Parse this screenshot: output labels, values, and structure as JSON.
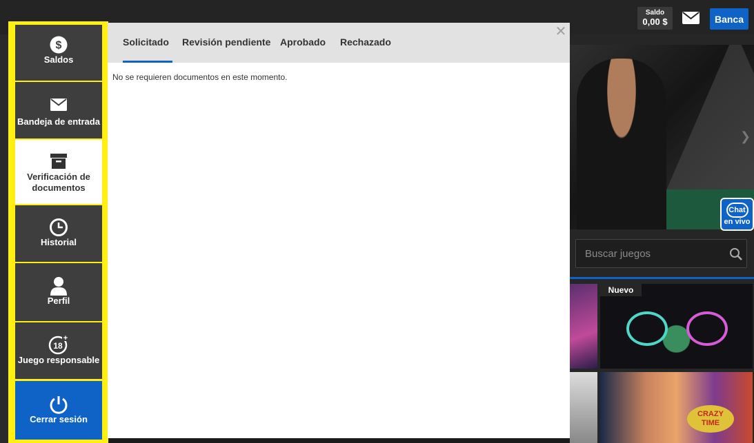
{
  "header": {
    "balance_label": "Saldo",
    "balance_value": "0,00 $",
    "mail_icon": "envelope-icon",
    "banca_label": "Banca"
  },
  "background": {
    "chat_line1": "Chat",
    "chat_line2": "en vivo",
    "search_placeholder": "Buscar juegos",
    "search_icon": "magnifier-icon",
    "new_badge": "Nuevo",
    "crazy_line1": "CRAZY",
    "crazy_line2": "TIME"
  },
  "menu": {
    "items": [
      {
        "label": "Saldos",
        "icon": "dollar-coin-icon"
      },
      {
        "label": "Bandeja de entrada",
        "icon": "envelope-icon"
      },
      {
        "label": "Verificación de documentos",
        "icon": "archive-box-icon"
      },
      {
        "label": "Historial",
        "icon": "clock-icon"
      },
      {
        "label": "Perfil",
        "icon": "user-icon"
      },
      {
        "label": "Juego responsable",
        "icon": "eighteen-plus-icon"
      },
      {
        "label": "Cerrar sesión",
        "icon": "power-icon"
      }
    ],
    "active": "Verificación de documentos",
    "highlight_color": "#ffef12",
    "accent_color": "#0f63c6"
  },
  "modal": {
    "tabs": [
      "Solicitado",
      "Revisión pendiente",
      "Aprobado",
      "Rechazado"
    ],
    "active_tab": "Solicitado",
    "message": "No se requieren documentos en este momento.",
    "close_icon": "close-icon"
  }
}
